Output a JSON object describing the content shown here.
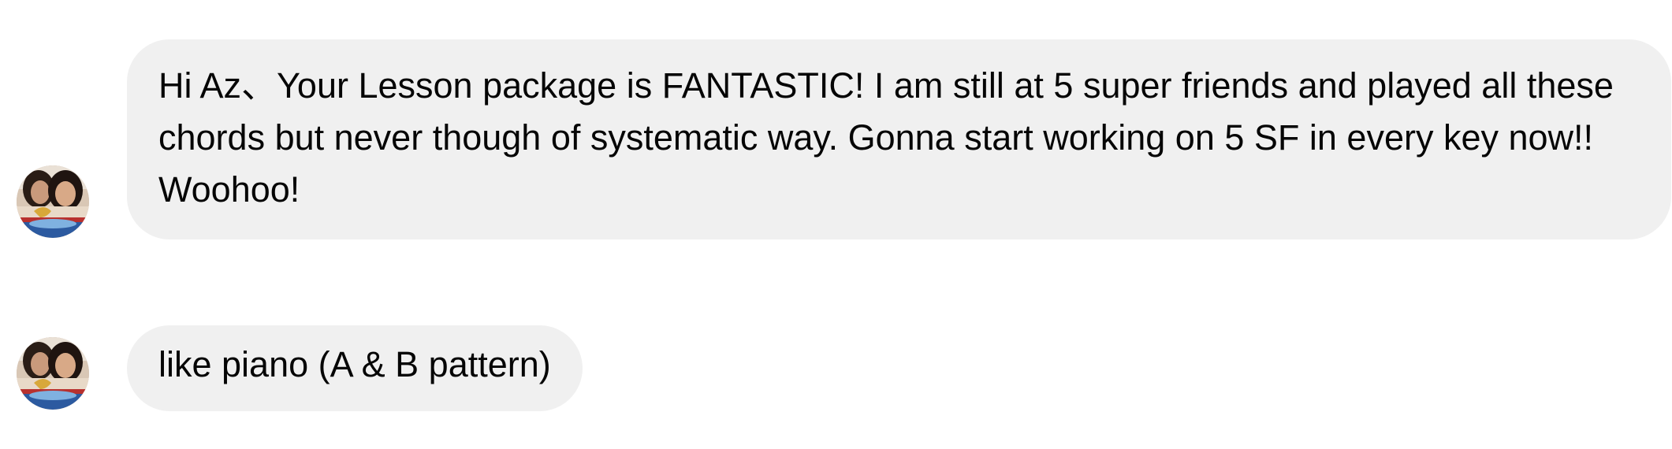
{
  "messages": [
    {
      "text": "Hi Az、Your Lesson package is FANTASTIC! I am still at 5 super friends and played all these chords but never though of systematic way.  Gonna start working on 5 SF in every key now!! Woohoo!"
    },
    {
      "text": "like piano (A & B pattern)"
    }
  ],
  "colors": {
    "bubble_background": "#f0f0f0",
    "text": "#050505",
    "page_background": "#ffffff"
  },
  "icons": {
    "avatar": "profile-photo-avatar"
  }
}
